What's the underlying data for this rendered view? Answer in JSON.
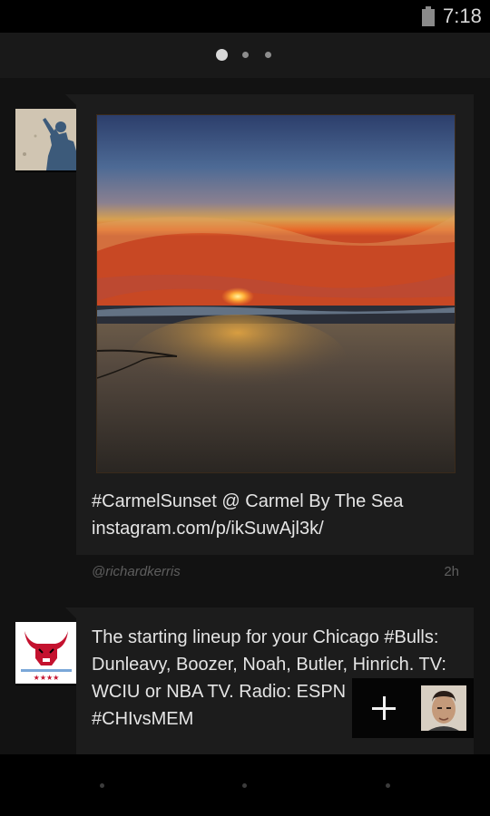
{
  "status": {
    "time": "7:18",
    "battery_icon": "battery-icon"
  },
  "pager": {
    "pages": 3,
    "active_index": 0
  },
  "tweets": [
    {
      "avatar_icon": "user-avatar-shadow",
      "text_line1": "#CarmelSunset @ Carmel By The Sea",
      "text_line2": "instagram.com/p/ikSuwAjl3k/",
      "handle": "@richardkerris",
      "time": "2h",
      "media_icon": "sunset-photo"
    },
    {
      "avatar_icon": "bulls-logo",
      "text_line1": "The starting lineup for your Chicago #Bulls:",
      "text_line2": "Dunleavy, Boozer, Noah, Butler, Hinrich. TV:",
      "text_line3": "WCIU or NBA TV. Radio: ESPN 1000.",
      "text_line4": "#CHIvsMEM"
    }
  ],
  "compose": {
    "icon": "plus-icon",
    "account_icon": "profile-avatar"
  },
  "navbar": {
    "icons": [
      "back-icon",
      "home-icon",
      "recents-icon"
    ]
  }
}
